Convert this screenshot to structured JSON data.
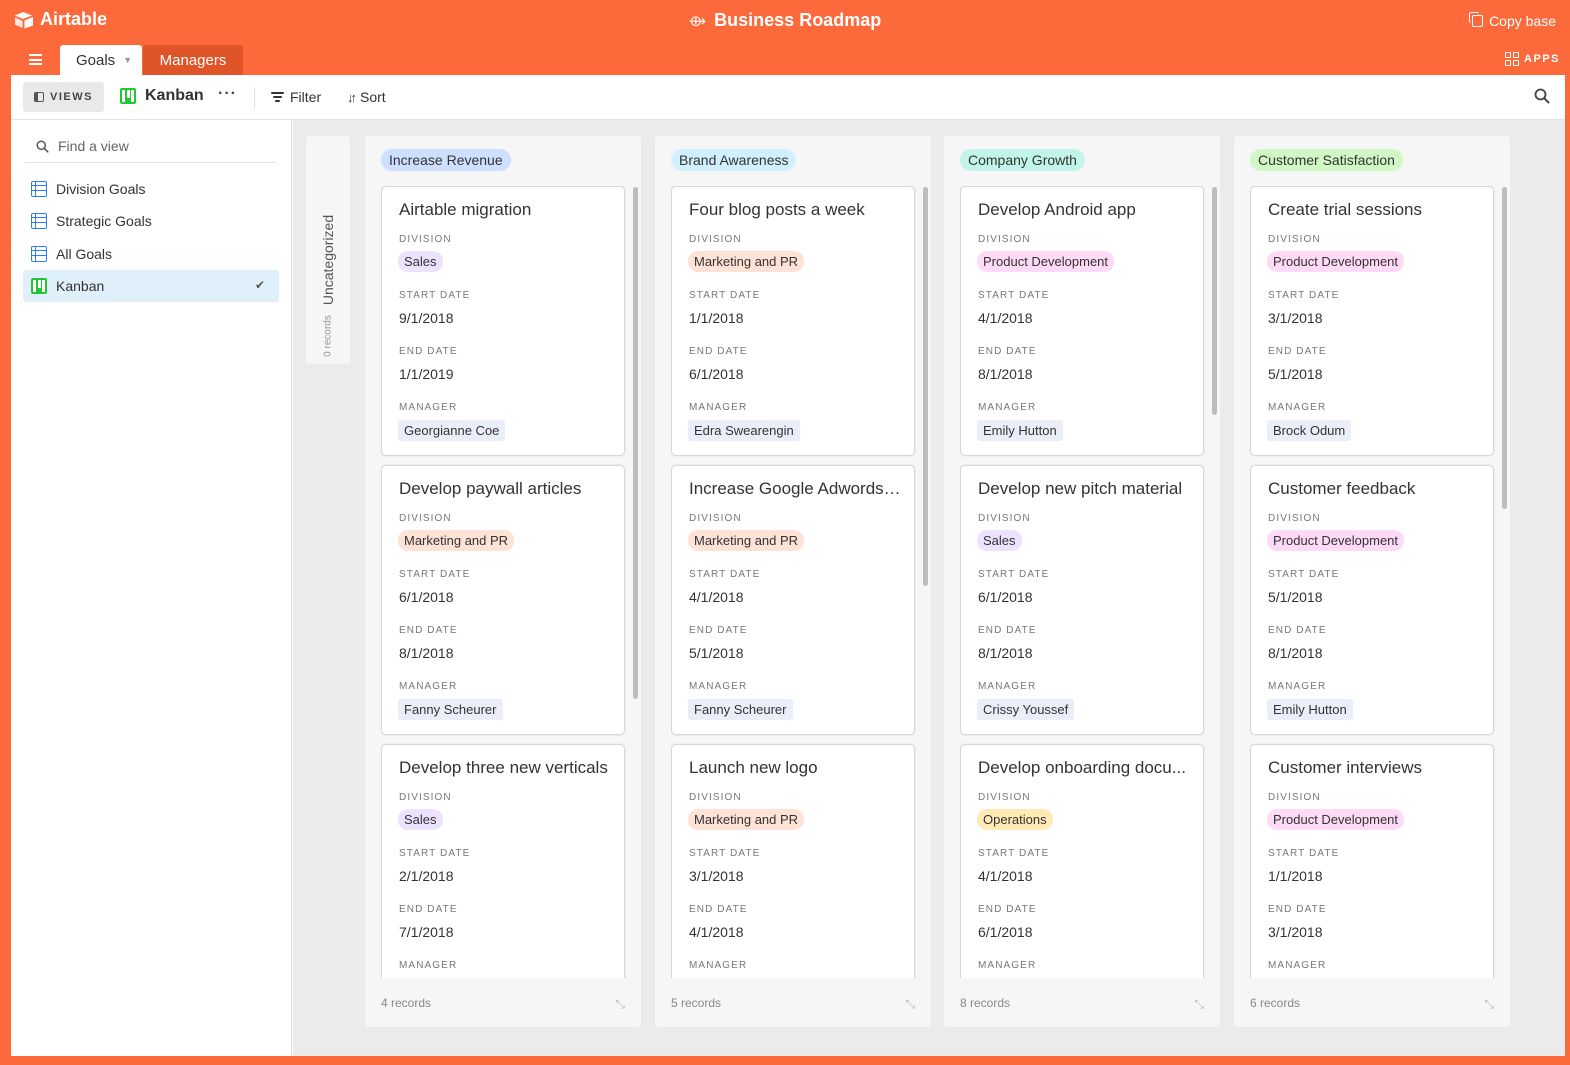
{
  "topbar": {
    "app_name": "Airtable",
    "base_title": "Business Roadmap",
    "base_glyph": "⟴",
    "copy_base": "Copy base"
  },
  "tabs": {
    "active": "Goals",
    "other": "Managers",
    "apps": "APPS"
  },
  "viewbar": {
    "views_label": "VIEWS",
    "view_name": "Kanban",
    "more": "···",
    "filter": "Filter",
    "sort": "Sort"
  },
  "sidebar": {
    "search_placeholder": "Find a view",
    "items": [
      {
        "label": "Division Goals",
        "icon": "grid-icon"
      },
      {
        "label": "Strategic Goals",
        "icon": "grid-icon"
      },
      {
        "label": "All Goals",
        "icon": "grid-icon"
      },
      {
        "label": "Kanban",
        "icon": "kanban-icon",
        "selected": true
      }
    ]
  },
  "board": {
    "uncategorized": {
      "label": "Uncategorized",
      "count": "0 records"
    },
    "field_labels": {
      "division": "DIVISION",
      "start": "START DATE",
      "end": "END DATE",
      "manager": "MANAGER"
    },
    "colors": {
      "pill_sales": "#ede2fe",
      "pill_marketing": "#fee2d5",
      "pill_product": "#ffdaf6",
      "pill_operations": "#ffeab6",
      "manager_bg": "#e9eef8",
      "head_revenue": "#cfdfff",
      "head_brand": "#d0f0fd",
      "head_growth": "#c2f5e9",
      "head_satisfaction": "#d1f7c4"
    },
    "stacks": [
      {
        "name": "Increase Revenue",
        "footer": "4 records",
        "cards": [
          {
            "title": "Airtable migration",
            "division": "Sales",
            "start": "9/1/2018",
            "end": "1/1/2019",
            "manager": "Georgianne Coe"
          },
          {
            "title": "Develop paywall articles",
            "division": "Marketing and PR",
            "start": "6/1/2018",
            "end": "8/1/2018",
            "manager": "Fanny Scheurer"
          },
          {
            "title": "Develop three new verticals",
            "division": "Sales",
            "start": "2/1/2018",
            "end": "7/1/2018",
            "manager": ""
          }
        ]
      },
      {
        "name": "Brand Awareness",
        "footer": "5 records",
        "cards": [
          {
            "title": "Four blog posts a week",
            "division": "Marketing and PR",
            "start": "1/1/2018",
            "end": "6/1/2018",
            "manager": "Edra Swearengin"
          },
          {
            "title": "Increase Google Adwords ...",
            "division": "Marketing and PR",
            "start": "4/1/2018",
            "end": "5/1/2018",
            "manager": "Fanny Scheurer"
          },
          {
            "title": "Launch new logo",
            "division": "Marketing and PR",
            "start": "3/1/2018",
            "end": "4/1/2018",
            "manager": ""
          }
        ]
      },
      {
        "name": "Company Growth",
        "footer": "8 records",
        "cards": [
          {
            "title": "Develop Android app",
            "division": "Product Development",
            "start": "4/1/2018",
            "end": "8/1/2018",
            "manager": "Emily Hutton"
          },
          {
            "title": "Develop new pitch material",
            "division": "Sales",
            "start": "6/1/2018",
            "end": "8/1/2018",
            "manager": "Crissy Youssef"
          },
          {
            "title": "Develop onboarding docu...",
            "division": "Operations",
            "start": "4/1/2018",
            "end": "6/1/2018",
            "manager": ""
          }
        ]
      },
      {
        "name": "Customer Satisfaction",
        "footer": "6 records",
        "cards": [
          {
            "title": "Create trial sessions",
            "division": "Product Development",
            "start": "3/1/2018",
            "end": "5/1/2018",
            "manager": "Brock Odum"
          },
          {
            "title": "Customer feedback",
            "division": "Product Development",
            "start": "5/1/2018",
            "end": "8/1/2018",
            "manager": "Emily Hutton"
          },
          {
            "title": "Customer interviews",
            "division": "Product Development",
            "start": "1/1/2018",
            "end": "3/1/2018",
            "manager": ""
          }
        ]
      }
    ]
  }
}
